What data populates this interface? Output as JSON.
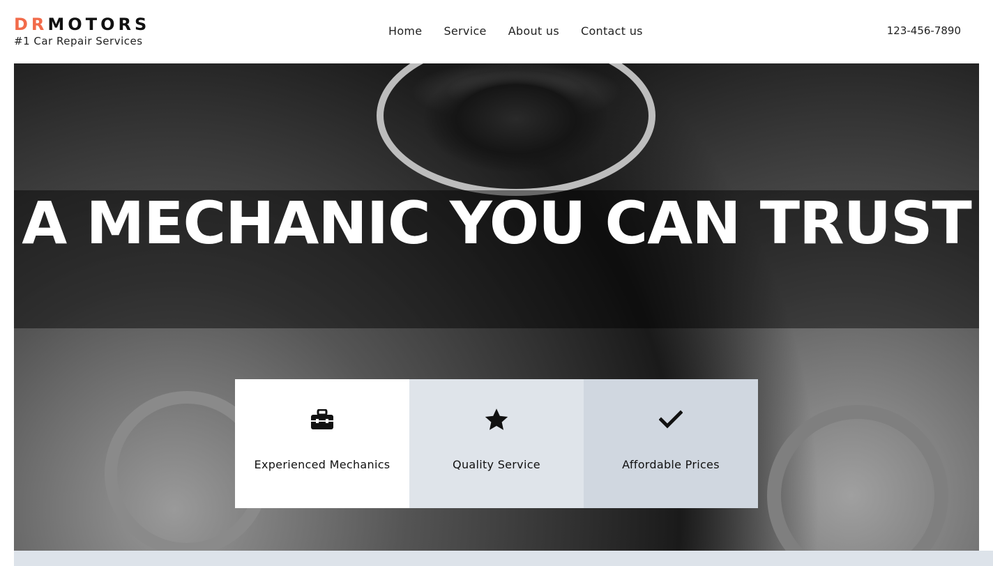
{
  "brand": {
    "logo_dr": "DR",
    "logo_motors": "MOTORS",
    "tagline": "#1 Car Repair Services",
    "accent_color": "#f26b4a"
  },
  "nav": {
    "items": [
      "Home",
      "Service",
      "About us",
      "Contact us"
    ]
  },
  "header": {
    "phone": "123-456-7890"
  },
  "hero": {
    "title": "A MECHANIC YOU CAN TRUST"
  },
  "features": [
    {
      "label": "Experienced Mechanics",
      "icon": "toolbox-icon",
      "bg": "#ffffff"
    },
    {
      "label": "Quality Service",
      "icon": "star-icon",
      "bg": "#dfe4ea"
    },
    {
      "label": "Affordable Prices",
      "icon": "checkmark-icon",
      "bg": "#d0d7e0"
    }
  ]
}
